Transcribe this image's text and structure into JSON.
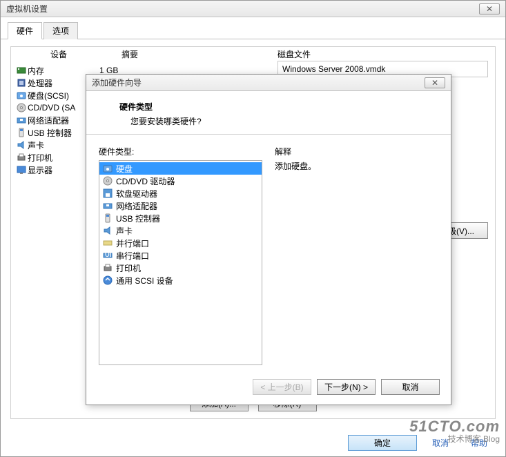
{
  "main_window": {
    "title": "虚拟机设置",
    "tabs": {
      "hardware": "硬件",
      "options": "选项"
    },
    "columns": {
      "device": "设备",
      "summary": "摘要"
    },
    "hardware_items": [
      {
        "icon": "memory-icon",
        "label": "内存",
        "summary": "1 GB"
      },
      {
        "icon": "cpu-icon",
        "label": "处理器",
        "summary": ""
      },
      {
        "icon": "harddisk-icon",
        "label": "硬盘(SCSI)",
        "summary": ""
      },
      {
        "icon": "cd-icon",
        "label": "CD/DVD (SA",
        "summary": ""
      },
      {
        "icon": "network-icon",
        "label": "网络适配器",
        "summary": ""
      },
      {
        "icon": "usb-icon",
        "label": "USB 控制器",
        "summary": ""
      },
      {
        "icon": "sound-icon",
        "label": "声卡",
        "summary": ""
      },
      {
        "icon": "printer-icon",
        "label": "打印机",
        "summary": ""
      },
      {
        "icon": "display-icon",
        "label": "显示器",
        "summary": ""
      }
    ],
    "disk_file_label": "磁盘文件",
    "disk_file_value": "Windows Server 2008.vmdk",
    "advanced_btn": "高级(V)...",
    "add_btn": "添加(A)...",
    "remove_btn": "移除(R)",
    "ok_btn": "确定",
    "cancel_btn": "取消",
    "help_btn": "帮助"
  },
  "wizard": {
    "title": "添加硬件向导",
    "heading": "硬件类型",
    "subheading": "您要安装哪类硬件?",
    "list_label": "硬件类型:",
    "explain_label": "解释",
    "explain_text": "添加硬盘。",
    "items": [
      {
        "icon": "harddisk-icon",
        "label": "硬盘",
        "selected": true
      },
      {
        "icon": "cd-icon",
        "label": "CD/DVD 驱动器"
      },
      {
        "icon": "floppy-icon",
        "label": "软盘驱动器"
      },
      {
        "icon": "network-icon",
        "label": "网络适配器"
      },
      {
        "icon": "usb-icon",
        "label": "USB 控制器"
      },
      {
        "icon": "sound-icon",
        "label": "声卡"
      },
      {
        "icon": "parallel-icon",
        "label": "并行端口"
      },
      {
        "icon": "serial-icon",
        "label": "串行端口"
      },
      {
        "icon": "printer-icon",
        "label": "打印机"
      },
      {
        "icon": "scsi-icon",
        "label": "通用 SCSI 设备"
      }
    ],
    "back_btn": "< 上一步(B)",
    "next_btn": "下一步(N) >",
    "cancel_btn": "取消"
  },
  "watermark": {
    "line1": "51CTO.com",
    "line2": "技术博客  Blog"
  }
}
